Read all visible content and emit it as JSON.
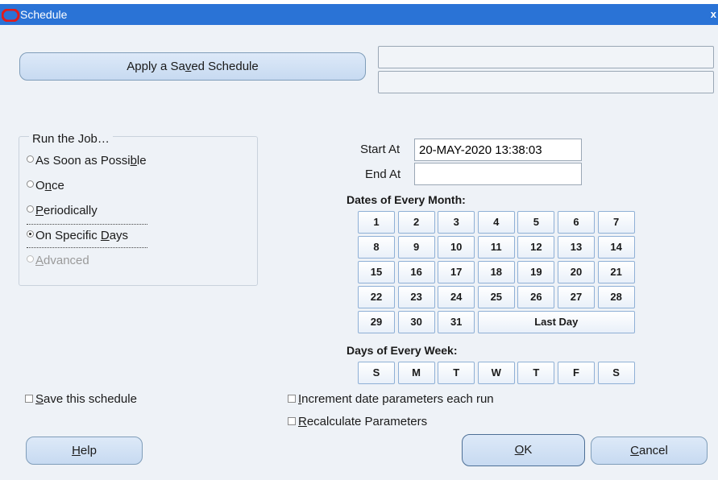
{
  "window": {
    "title": "Schedule",
    "close_glyph": "x"
  },
  "saved_schedule": {
    "button_label_pre": "Apply a Sa",
    "button_label_u": "v",
    "button_label_post": "ed Schedule"
  },
  "run_the_job": {
    "legend": "Run the Job…",
    "options": [
      {
        "pre": "As Soon as Possi",
        "u": "b",
        "post": "le",
        "checked": false,
        "disabled": false
      },
      {
        "pre": "O",
        "u": "n",
        "post": "ce",
        "checked": false,
        "disabled": false
      },
      {
        "pre": "",
        "u": "P",
        "post": "eriodically",
        "checked": false,
        "disabled": false
      },
      {
        "pre": "On Specific ",
        "u": "D",
        "post": "ays",
        "checked": true,
        "disabled": false
      },
      {
        "pre": "",
        "u": "A",
        "post": "dvanced",
        "checked": false,
        "disabled": true
      }
    ]
  },
  "start_at": {
    "label": "Start At",
    "value": "20-MAY-2020 13:38:03"
  },
  "end_at": {
    "label": "End At",
    "value": ""
  },
  "dates_of_month": {
    "heading": "Dates of Every Month:",
    "rows": [
      [
        "1",
        "2",
        "3",
        "4",
        "5",
        "6",
        "7"
      ],
      [
        "8",
        "9",
        "10",
        "11",
        "12",
        "13",
        "14"
      ],
      [
        "15",
        "16",
        "17",
        "18",
        "19",
        "20",
        "21"
      ],
      [
        "22",
        "23",
        "24",
        "25",
        "26",
        "27",
        "28"
      ],
      [
        "29",
        "30",
        "31"
      ]
    ],
    "last_day": "Last Day"
  },
  "days_of_week": {
    "heading": "Days of Every Week:",
    "days": [
      "S",
      "M",
      "T",
      "W",
      "T",
      "F",
      "S"
    ]
  },
  "save_schedule": {
    "pre": "",
    "u": "S",
    "post": "ave this schedule"
  },
  "increment_dates": {
    "pre": "",
    "u": "I",
    "post": "ncrement date parameters each run"
  },
  "recalculate": {
    "pre": "",
    "u": "R",
    "post": "ecalculate Parameters"
  },
  "buttons": {
    "help": {
      "pre": "",
      "u": "H",
      "post": "elp"
    },
    "ok": {
      "pre": "",
      "u": "O",
      "post": "K"
    },
    "cancel": {
      "pre": "",
      "u": "C",
      "post": "ancel"
    }
  },
  "colors": {
    "titlebar": "#2a73d6",
    "dialog_bg": "#eef2f7",
    "button_bg": "#c7daf1",
    "logo": "#e21b1b"
  }
}
